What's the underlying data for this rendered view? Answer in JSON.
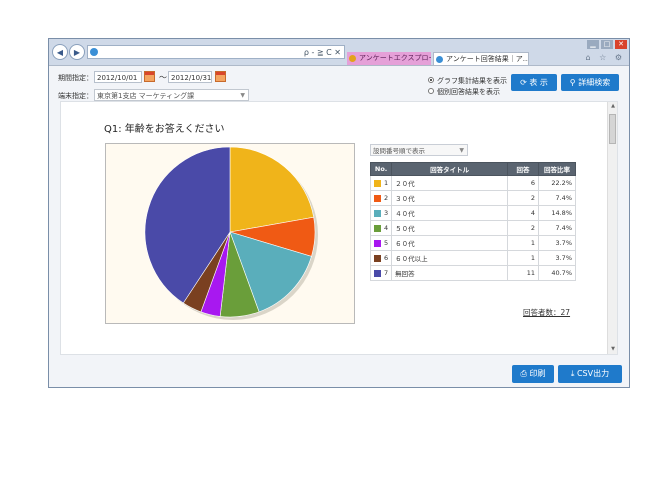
{
  "browser": {
    "tab_active": "アンケートエクスプローラー",
    "tab_second": "アンケート回答結果｜ア...",
    "addr_tools": "ρ - ≧ C ✕",
    "toolbar_icons": "⌂ ☆ ⚙"
  },
  "filters": {
    "period_label": "期間指定：",
    "date_from": "2012/10/01",
    "tilde": "～",
    "date_to": "2012/10/31",
    "terminal_label": "端末指定：",
    "terminal_value": "東京第1支店 マーケティング課",
    "radio_graph": "グラフ集計結果を表示",
    "radio_individual": "個別回答結果を表示",
    "display_button": "表 示",
    "detail_search_button": "詳細検索"
  },
  "question": {
    "title": "Q1: 年齢をお答えください",
    "order_select": "設問番号順で表示"
  },
  "table": {
    "headers": [
      "No.",
      "回答タイトル",
      "回答",
      "回答比率"
    ],
    "rows": [
      {
        "no": "1",
        "title": "２０代",
        "count": "6",
        "ratio": "22.2%",
        "color": "#f0b41a"
      },
      {
        "no": "2",
        "title": "３０代",
        "count": "2",
        "ratio": "7.4%",
        "color": "#f05a14"
      },
      {
        "no": "3",
        "title": "４０代",
        "count": "4",
        "ratio": "14.8%",
        "color": "#5aaebb"
      },
      {
        "no": "4",
        "title": "５０代",
        "count": "2",
        "ratio": "7.4%",
        "color": "#6a9e3a"
      },
      {
        "no": "5",
        "title": "６０代",
        "count": "1",
        "ratio": "3.7%",
        "color": "#a818f0"
      },
      {
        "no": "6",
        "title": "６０代以上",
        "count": "1",
        "ratio": "3.7%",
        "color": "#7a4020"
      },
      {
        "no": "7",
        "title": "無回答",
        "count": "11",
        "ratio": "40.7%",
        "color": "#4a4aa8"
      }
    ],
    "total": "回答者数：27"
  },
  "chart_data": {
    "type": "pie",
    "categories": [
      "２０代",
      "３０代",
      "４０代",
      "５０代",
      "６０代",
      "６０代以上",
      "無回答"
    ],
    "values": [
      6,
      2,
      4,
      2,
      1,
      1,
      11
    ],
    "colors": [
      "#f0b41a",
      "#f05a14",
      "#5aaebb",
      "#6a9e3a",
      "#a818f0",
      "#7a4020",
      "#4a4aa8"
    ],
    "title": ""
  },
  "footer": {
    "print_button": "印刷",
    "csv_button": "CSV出力"
  }
}
